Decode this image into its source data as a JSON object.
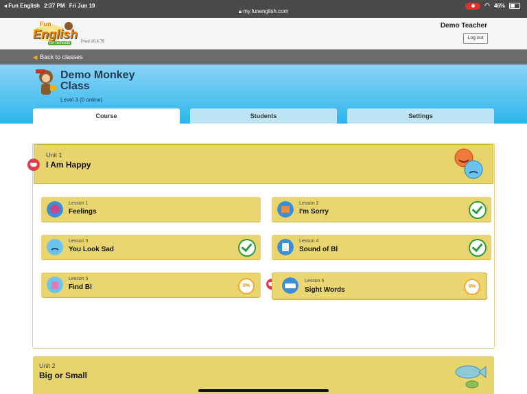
{
  "status_bar": {
    "app": "◂ Fun English",
    "time": "2:37 PM",
    "date": "Fri Jun 19",
    "url": "my.funenglish.com",
    "battery": "46%"
  },
  "header": {
    "logo_fun": "Fun",
    "logo_english": "English",
    "logo_schools": "for Schools",
    "version": "Prod 20.4.75",
    "user": "Demo Teacher",
    "logout_label": "Log out"
  },
  "nav": {
    "back_label": "Back to classes"
  },
  "class_info": {
    "title": "Demo Monkey Class",
    "level": "Level 3 (0 online)"
  },
  "tabs": [
    {
      "label": "Course"
    },
    {
      "label": "Students"
    },
    {
      "label": "Settings"
    }
  ],
  "units": [
    {
      "label": "Unit 1",
      "title": "I Am Happy",
      "lessons": [
        {
          "number": "Lesson 1",
          "title": "Feelings",
          "status": ""
        },
        {
          "number": "Lesson 2",
          "title": "I'm Sorry",
          "status": "complete"
        },
        {
          "number": "Lesson 3",
          "title": "You Look Sad",
          "status": "complete"
        },
        {
          "number": "Lesson 4",
          "title": "Sound of Bl",
          "status": "complete"
        },
        {
          "number": "Lesson 5",
          "title": "Find Bl",
          "status": "0%"
        },
        {
          "number": "Lesson 6",
          "title": "Sight Words",
          "status": "0%"
        }
      ]
    },
    {
      "label": "Unit 2",
      "title": "Big or Small"
    }
  ],
  "colors": {
    "unit_yellow": "#e7d46d",
    "hero_blue": "#2db6ec",
    "complete_green": "#2e9b3a",
    "progress_orange": "#f5a623",
    "cap_red": "#e33a4a"
  },
  "icons": {
    "teacher_cap": "graduation-cap-icon",
    "complete": "checkmark-icon"
  }
}
